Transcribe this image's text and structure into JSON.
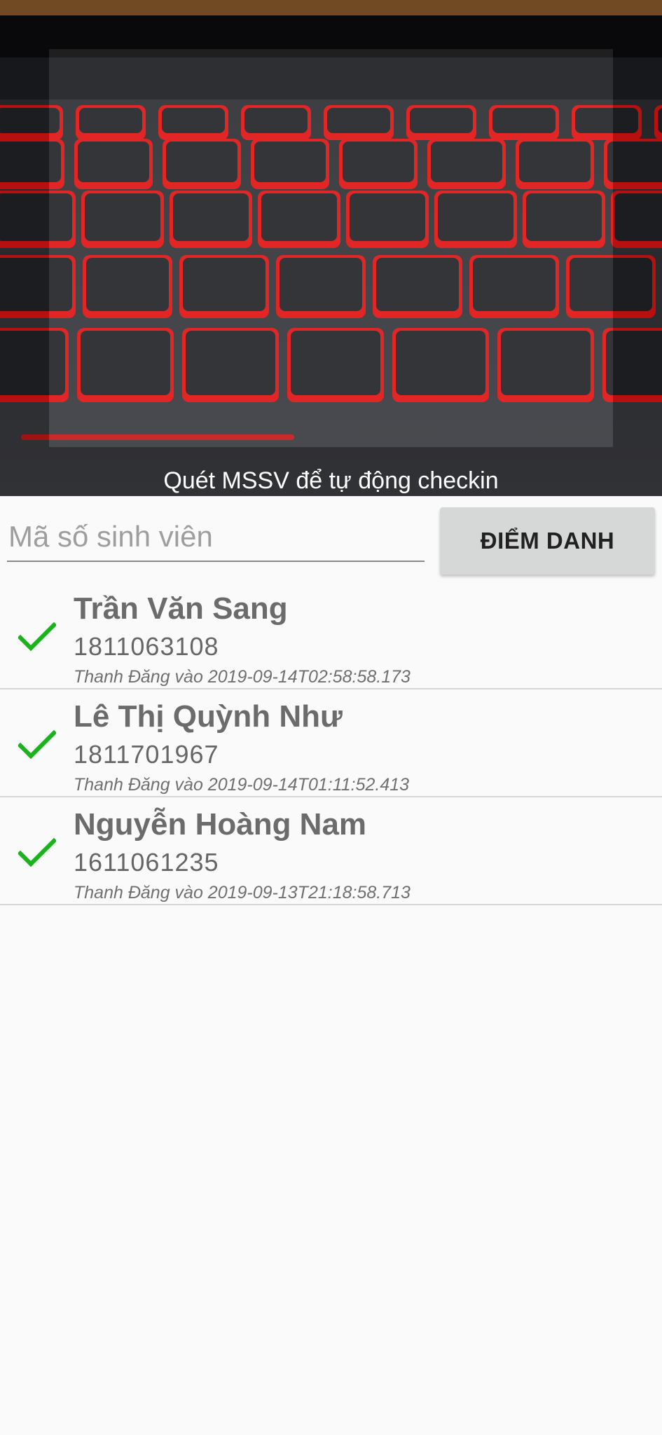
{
  "scanner": {
    "hint": "Quét MSSV để tự động checkin"
  },
  "form": {
    "placeholder": "Mã số sinh viên",
    "value": "",
    "button_label": "ĐIỂM DANH"
  },
  "checkins": [
    {
      "name": "Trần Văn Sang",
      "mssv": "1811063108",
      "meta": "Thanh Đăng vào 2019-09-14T02:58:58.173",
      "icon": "check-icon"
    },
    {
      "name": "Lê Thị Quỳnh Như",
      "mssv": "1811701967",
      "meta": "Thanh Đăng vào 2019-09-14T01:11:52.413",
      "icon": "check-icon"
    },
    {
      "name": "Nguyễn Hoàng Nam",
      "mssv": "1611061235",
      "meta": "Thanh Đăng vào 2019-09-13T21:18:58.713",
      "icon": "check-icon"
    }
  ],
  "colors": {
    "check": "#1bb31b",
    "button_bg": "#d6d7d7",
    "key_glow": "#e01414"
  }
}
